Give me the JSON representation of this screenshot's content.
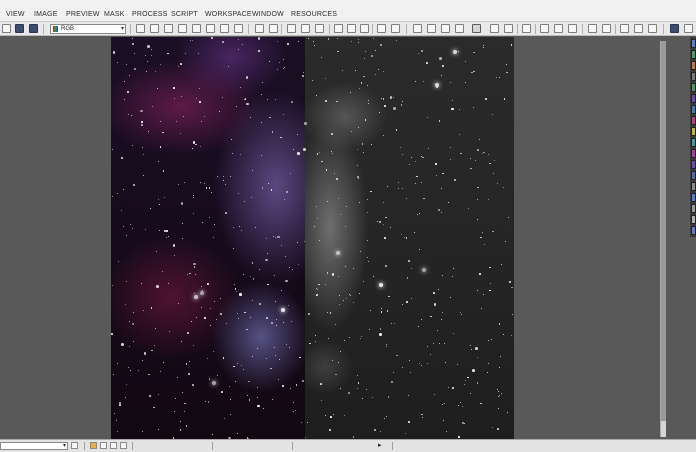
{
  "menu": {
    "items": [
      {
        "label": "VIEW"
      },
      {
        "label": "IMAGE"
      },
      {
        "label": "PREVIEW"
      },
      {
        "label": "MASK"
      },
      {
        "label": "PROCESS"
      },
      {
        "label": "SCRIPT"
      },
      {
        "label": "WORKSPACE"
      },
      {
        "label": "WINDOW"
      },
      {
        "label": "RESOURCES"
      }
    ]
  },
  "toolbar": {
    "channel_select": {
      "value": "RGB",
      "icon": "rgb-swatch-icon"
    }
  },
  "statusbar": {
    "play_icon": "▸"
  },
  "colors": {
    "menubar_bg": "#f1f1f1",
    "workspace_bg": "#595959",
    "toolbar_bg": "#e9e9e9"
  }
}
